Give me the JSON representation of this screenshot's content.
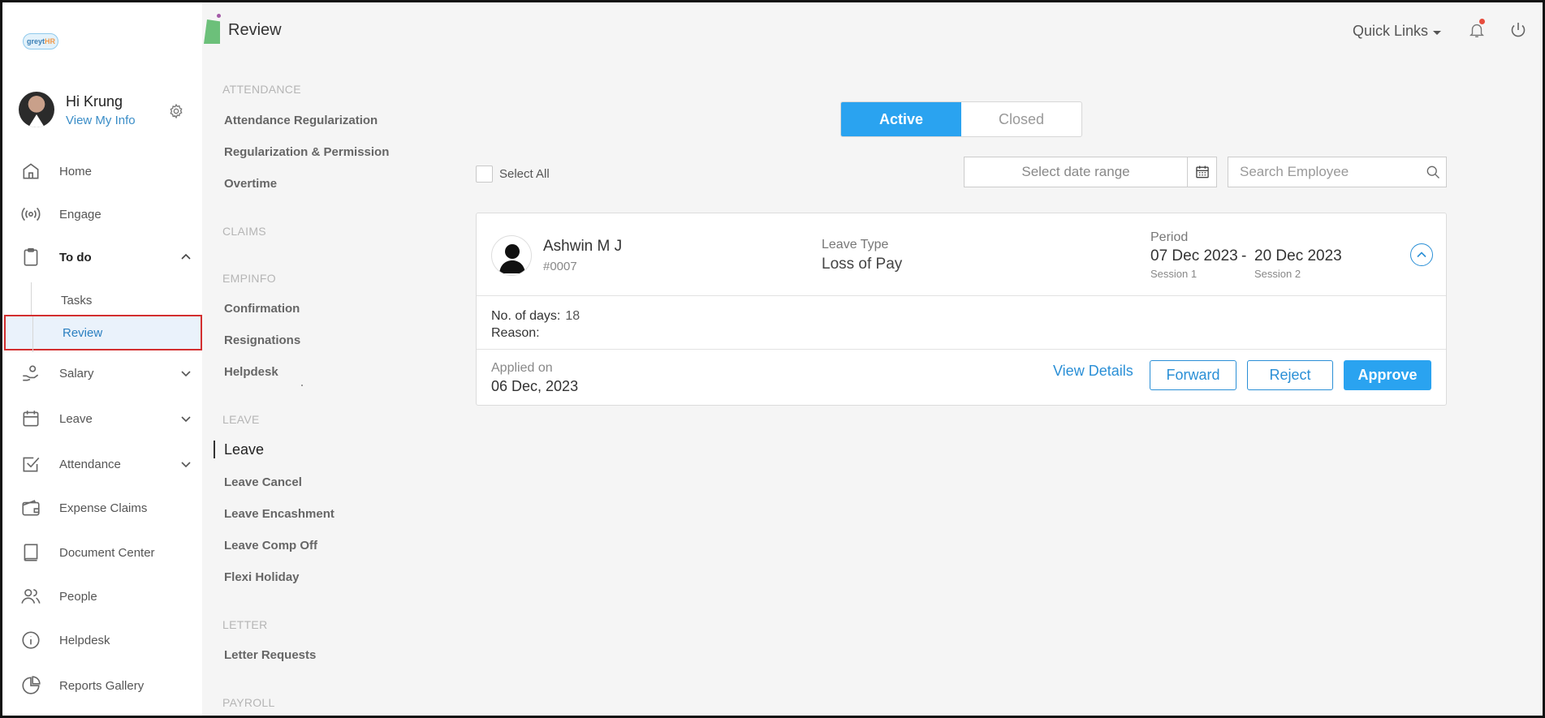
{
  "app": {
    "logo_text_a": "greyt",
    "logo_text_b": "HR"
  },
  "header": {
    "title": "Review",
    "quick_links": "Quick Links"
  },
  "profile": {
    "greeting": "Hi Krung",
    "view_info": "View My Info"
  },
  "sidebar": {
    "items": [
      {
        "label": "Home",
        "icon": "home-icon"
      },
      {
        "label": "Engage",
        "icon": "broadcast-icon"
      },
      {
        "label": "To do",
        "icon": "clipboard-icon"
      },
      {
        "label": "Salary",
        "icon": "hand-coin-icon"
      },
      {
        "label": "Leave",
        "icon": "calendar-icon"
      },
      {
        "label": "Attendance",
        "icon": "check-square-icon"
      },
      {
        "label": "Expense Claims",
        "icon": "wallet-icon"
      },
      {
        "label": "Document Center",
        "icon": "book-icon"
      },
      {
        "label": "People",
        "icon": "people-icon"
      },
      {
        "label": "Helpdesk",
        "icon": "info-icon"
      },
      {
        "label": "Reports Gallery",
        "icon": "pie-chart-icon"
      }
    ],
    "todo_sub": [
      {
        "label": "Tasks"
      },
      {
        "label": "Review"
      }
    ]
  },
  "categories": {
    "attendance": {
      "head": "ATTENDANCE",
      "links": [
        "Attendance Regularization",
        "Regularization & Permission",
        "Overtime"
      ]
    },
    "claims": {
      "head": "CLAIMS"
    },
    "empinfo": {
      "head": "EMPINFO",
      "links": [
        "Confirmation",
        "Resignations",
        "Helpdesk"
      ]
    },
    "leave": {
      "head": "LEAVE",
      "links": [
        "Leave",
        "Leave Cancel",
        "Leave Encashment",
        "Leave Comp Off",
        "Flexi Holiday"
      ]
    },
    "letter": {
      "head": "LETTER",
      "links": [
        "Letter Requests"
      ]
    },
    "payroll": {
      "head": "PAYROLL"
    }
  },
  "tabs": {
    "active": "Active",
    "closed": "Closed"
  },
  "filters": {
    "select_all": "Select All",
    "date_placeholder": "Select date range",
    "search_placeholder": "Search Employee"
  },
  "request": {
    "name": "Ashwin M J",
    "id": "#0007",
    "leave_type_label": "Leave Type",
    "leave_type": "Loss of Pay",
    "period_label": "Period",
    "from": "07 Dec 2023",
    "dash": "-",
    "to": "20 Dec 2023",
    "from_session": "Session 1",
    "to_session": "Session 2",
    "days_label": "No. of days:",
    "days": "18",
    "reason_label": "Reason:",
    "applied_label": "Applied on",
    "applied_on": "06 Dec, 2023",
    "view_details": "View Details",
    "forward": "Forward",
    "reject": "Reject",
    "approve": "Approve"
  },
  "colors": {
    "accent": "#2aa3f0",
    "link": "#2a8fd6",
    "highlight_border": "#d32f2f"
  }
}
